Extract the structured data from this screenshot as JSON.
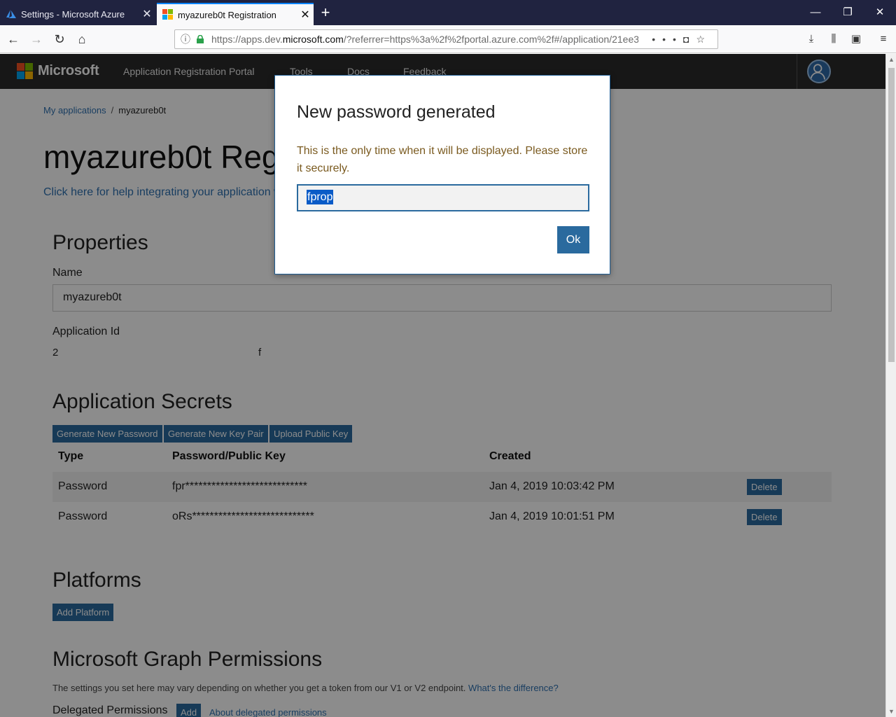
{
  "browser": {
    "tabs": [
      {
        "title": "Settings - Microsoft Azure",
        "active": false
      },
      {
        "title": "myazureb0t Registration",
        "active": true
      }
    ],
    "url_prefix": "https://apps.dev.",
    "url_domain": "microsoft.com",
    "url_suffix": "/?referrer=https%3a%2f%2fportal.azure.com%2f#/application/21ee3",
    "icons": {
      "back": "back-arrow-icon",
      "forward": "forward-arrow-icon",
      "reload": "reload-icon",
      "home": "home-icon",
      "more": "more-icon",
      "pocket": "pocket-icon",
      "bookmark": "bookmark-star-icon",
      "downloads": "download-icon",
      "library": "library-icon",
      "sidebar": "sidebar-icon",
      "menu": "hamburger-icon"
    }
  },
  "header": {
    "brand": "Microsoft",
    "nav": [
      "Application Registration Portal",
      "Tools",
      "Docs",
      "Feedback"
    ]
  },
  "breadcrumb": {
    "parent": "My applications",
    "separator": "/",
    "current": "myazureb0t"
  },
  "page": {
    "title": "myazureb0t Registration",
    "help_link": "Click here for help integrating your application with Microsoft."
  },
  "properties": {
    "heading": "Properties",
    "name_label": "Name",
    "name_value": "myazureb0t",
    "app_id_label": "Application Id",
    "app_id_start": "2",
    "app_id_end": "f"
  },
  "secrets": {
    "heading": "Application Secrets",
    "buttons": [
      "Generate New Password",
      "Generate New Key Pair",
      "Upload Public Key"
    ],
    "columns": [
      "Type",
      "Password/Public Key",
      "Created"
    ],
    "rows": [
      {
        "type": "Password",
        "key": "fpr****************************",
        "created": "Jan 4, 2019 10:03:42 PM",
        "action": "Delete"
      },
      {
        "type": "Password",
        "key": "oRs****************************",
        "created": "Jan 4, 2019 10:01:51 PM",
        "action": "Delete"
      }
    ]
  },
  "platforms": {
    "heading": "Platforms",
    "add_button": "Add Platform"
  },
  "graph": {
    "heading": "Microsoft Graph Permissions",
    "note": "The settings you set here may vary depending on whether you get a token from our V1 or V2 endpoint.",
    "note_link": "What's the difference?",
    "delegated_label": "Delegated Permissions",
    "add_button": "Add",
    "about_link": "About delegated permissions"
  },
  "modal": {
    "title": "New password generated",
    "message": "This is the only time when it will be displayed. Please store it securely.",
    "password_value": "fprop",
    "ok_label": "Ok"
  },
  "colors": {
    "accent": "#2a6a9e",
    "link": "#2f71b1",
    "header_bg": "#2b2b2b",
    "warning_text": "#7a5a1f"
  }
}
